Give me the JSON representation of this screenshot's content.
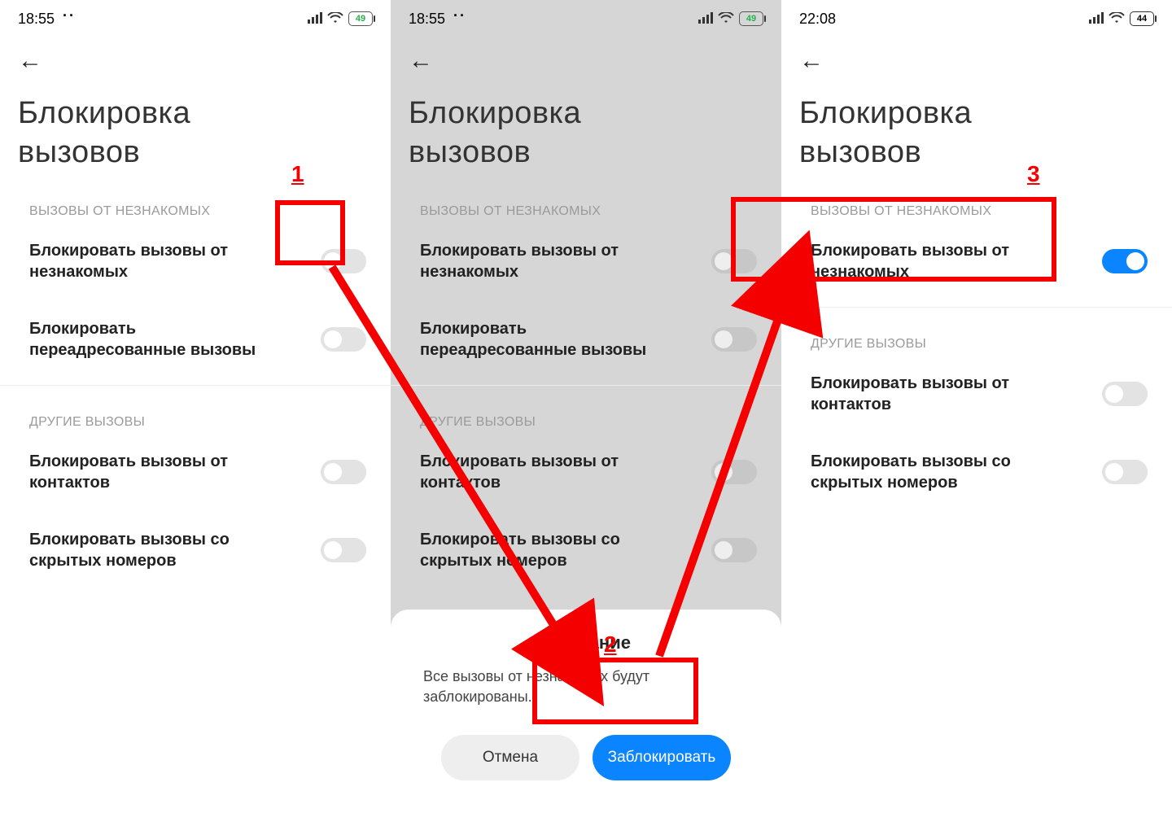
{
  "annots": {
    "step1": "1",
    "step2": "2",
    "step3": "3"
  },
  "screens": [
    {
      "time": "18:55",
      "battery": "49",
      "title_l1": "Блокировка",
      "title_l2": "вызовов",
      "section1": "ВЫЗОВЫ ОТ НЕЗНАКОМЫХ",
      "row1": "Блокировать вызовы от незнакомых",
      "row2": "Блокировать переадресованные вызовы",
      "section2": "ДРУГИЕ ВЫЗОВЫ",
      "row3": "Блокировать вызовы от контактов",
      "row4": "Блокировать вызовы со скрытых номеров"
    },
    {
      "time": "18:55",
      "battery": "49",
      "title_l1": "Блокировка",
      "title_l2": "вызовов",
      "section1": "ВЫЗОВЫ ОТ НЕЗНАКОМЫХ",
      "row1": "Блокировать вызовы от незнакомых",
      "row2": "Блокировать переадресованные вызовы",
      "section2": "ДРУГИЕ ВЫЗОВЫ",
      "row3": "Блокировать вызовы от контактов",
      "row4": "Блокировать вызовы со скрытых номеров",
      "sheet_title": "Внимание",
      "sheet_text": "Все вызовы от незнакомых будут заблокированы.",
      "cancel": "Отмена",
      "confirm": "Заблокировать"
    },
    {
      "time": "22:08",
      "battery": "44",
      "title_l1": "Блокировка",
      "title_l2": "вызовов",
      "section1": "ВЫЗОВЫ ОТ НЕЗНАКОМЫХ",
      "row1": "Блокировать вызовы от незнакомых",
      "section2": "ДРУГИЕ ВЫЗОВЫ",
      "row3": "Блокировать вызовы от контактов",
      "row4": "Блокировать вызовы со скрытых номеров"
    }
  ]
}
